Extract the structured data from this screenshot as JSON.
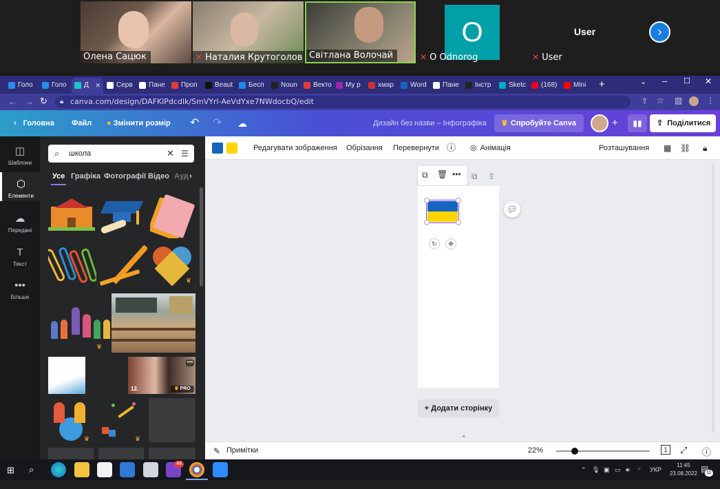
{
  "zoom": {
    "participants": [
      {
        "name": "Олена Сацюк",
        "muted": false
      },
      {
        "name": "Наталия Крутоголов",
        "muted": true
      },
      {
        "name": "Світлана Волочай",
        "muted": false
      },
      {
        "name": "O Odnorog",
        "muted": true,
        "initial": "O"
      },
      {
        "name": "User",
        "muted": true,
        "label": "User"
      }
    ]
  },
  "browser": {
    "tabs": [
      "Голо",
      "Голо",
      "Д",
      "Серв",
      "Пане",
      "Проп",
      "Beaut",
      "Бесп",
      "Noun",
      "Векто",
      "My p",
      "хмар",
      "Word",
      "Пане",
      "Інстр",
      "Sketc",
      "(168)",
      "Mini"
    ],
    "url": "canva.com/design/DAFKlPdcdlk/SmVYrl-AeVdYxe7NWdocbQ/edit"
  },
  "canva": {
    "header": {
      "home": "Головна",
      "file": "Файл",
      "resize": "Змінити розмір",
      "title": "Дизайн без назви – Інфографіка",
      "try_pro": "Спробуйте Canva Pro",
      "share": "Поділитися"
    },
    "rail": [
      "Шаблони",
      "Елементи",
      "Передані",
      "Текст",
      "Більше"
    ],
    "panel": {
      "search_value": "школа",
      "categories": [
        "Усе",
        "Графіка",
        "Фотографії",
        "Відео",
        "Ауд"
      ],
      "video_duration": "12.",
      "pro_badge": "PRO"
    },
    "toolbar": {
      "edit_image": "Редагувати зображення",
      "crop": "Обрізання",
      "flip": "Перевернути",
      "animate": "Анімація",
      "position": "Розташування"
    },
    "colors": {
      "blue": "#1565c0",
      "yellow": "#ffd400"
    },
    "add_page": "+ Додати сторінку",
    "notes": "Примітки",
    "zoom": "22%"
  },
  "taskbar": {
    "lang": "УКР",
    "time": "11:45",
    "date": "23.08.2022",
    "notif": "11",
    "badge": "48"
  }
}
